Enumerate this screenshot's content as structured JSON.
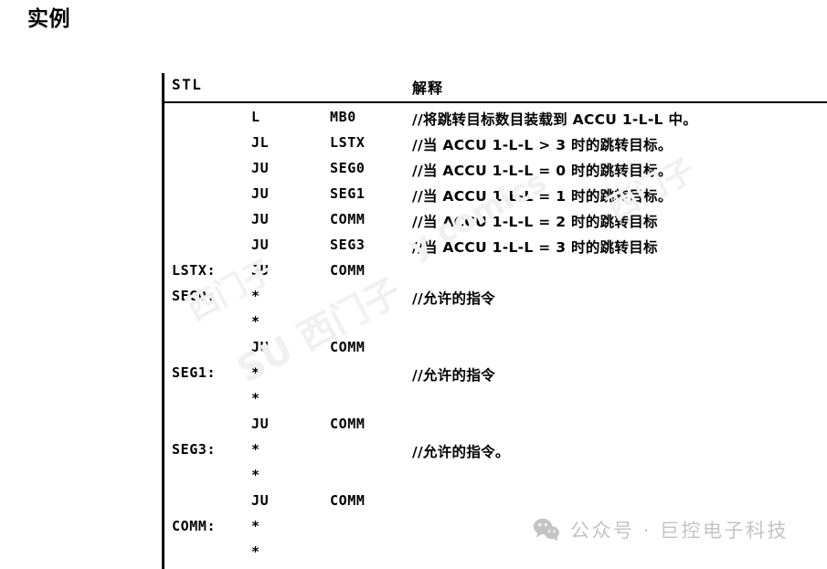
{
  "page": {
    "title": "实例"
  },
  "table": {
    "headers": {
      "stl": "STL",
      "description": "解释"
    },
    "rows": [
      {
        "label": "",
        "op": "L",
        "operand": "MB0",
        "comment": "//将跳转目标数目装载到 ACCU 1-L-L 中。"
      },
      {
        "label": "",
        "op": "JL",
        "operand": "LSTX",
        "comment": "//当 ACCU 1-L-L > 3 时的跳转目标。"
      },
      {
        "label": "",
        "op": "JU",
        "operand": "SEG0",
        "comment": "//当 ACCU 1-L-L = 0 时的跳转目标。"
      },
      {
        "label": "",
        "op": "JU",
        "operand": "SEG1",
        "comment": "//当 ACCU 1-L-L = 1 时的跳转目标。"
      },
      {
        "label": "",
        "op": "JU",
        "operand": "COMM",
        "comment": "//当 ACCU 1-L-L = 2 时的跳转目标"
      },
      {
        "label": "",
        "op": "JU",
        "operand": "SEG3",
        "comment": "//当 ACCU 1-L-L = 3 时的跳转目标"
      },
      {
        "label": "LSTX:",
        "op": "JU",
        "operand": "COMM",
        "comment": ""
      },
      {
        "label": "SEG0:",
        "op": "*",
        "operand": "",
        "comment": "//允许的指令"
      },
      {
        "label": "",
        "op": "*",
        "operand": "",
        "comment": ""
      },
      {
        "label": "",
        "op": "JU",
        "operand": "COMM",
        "comment": ""
      },
      {
        "label": "SEG1:",
        "op": "*",
        "operand": "",
        "comment": "//允许的指令"
      },
      {
        "label": "",
        "op": "*",
        "operand": "",
        "comment": ""
      },
      {
        "label": "",
        "op": "JU",
        "operand": "COMM",
        "comment": ""
      },
      {
        "label": "SEG3:",
        "op": "*",
        "operand": "",
        "comment": "//允许的指令。"
      },
      {
        "label": "",
        "op": "*",
        "operand": "",
        "comment": ""
      },
      {
        "label": "",
        "op": "JU",
        "operand": "COMM",
        "comment": ""
      },
      {
        "label": "COMM:",
        "op": "*",
        "operand": "",
        "comment": ""
      },
      {
        "label": "",
        "op": "*",
        "operand": "",
        "comment": ""
      }
    ]
  },
  "watermarks": {
    "a": "SU 西门子",
    "b": "y comics",
    "c": "西门子",
    "d": "西门子"
  },
  "footer": {
    "icon": "wechat-icon",
    "text": "公众号 · 巨控电子科技",
    "color": "#c4c4c4"
  },
  "colors": {
    "text": "#000000",
    "background": "#ffffff",
    "rule": "#000000",
    "watermark": "#f0f0f0"
  }
}
